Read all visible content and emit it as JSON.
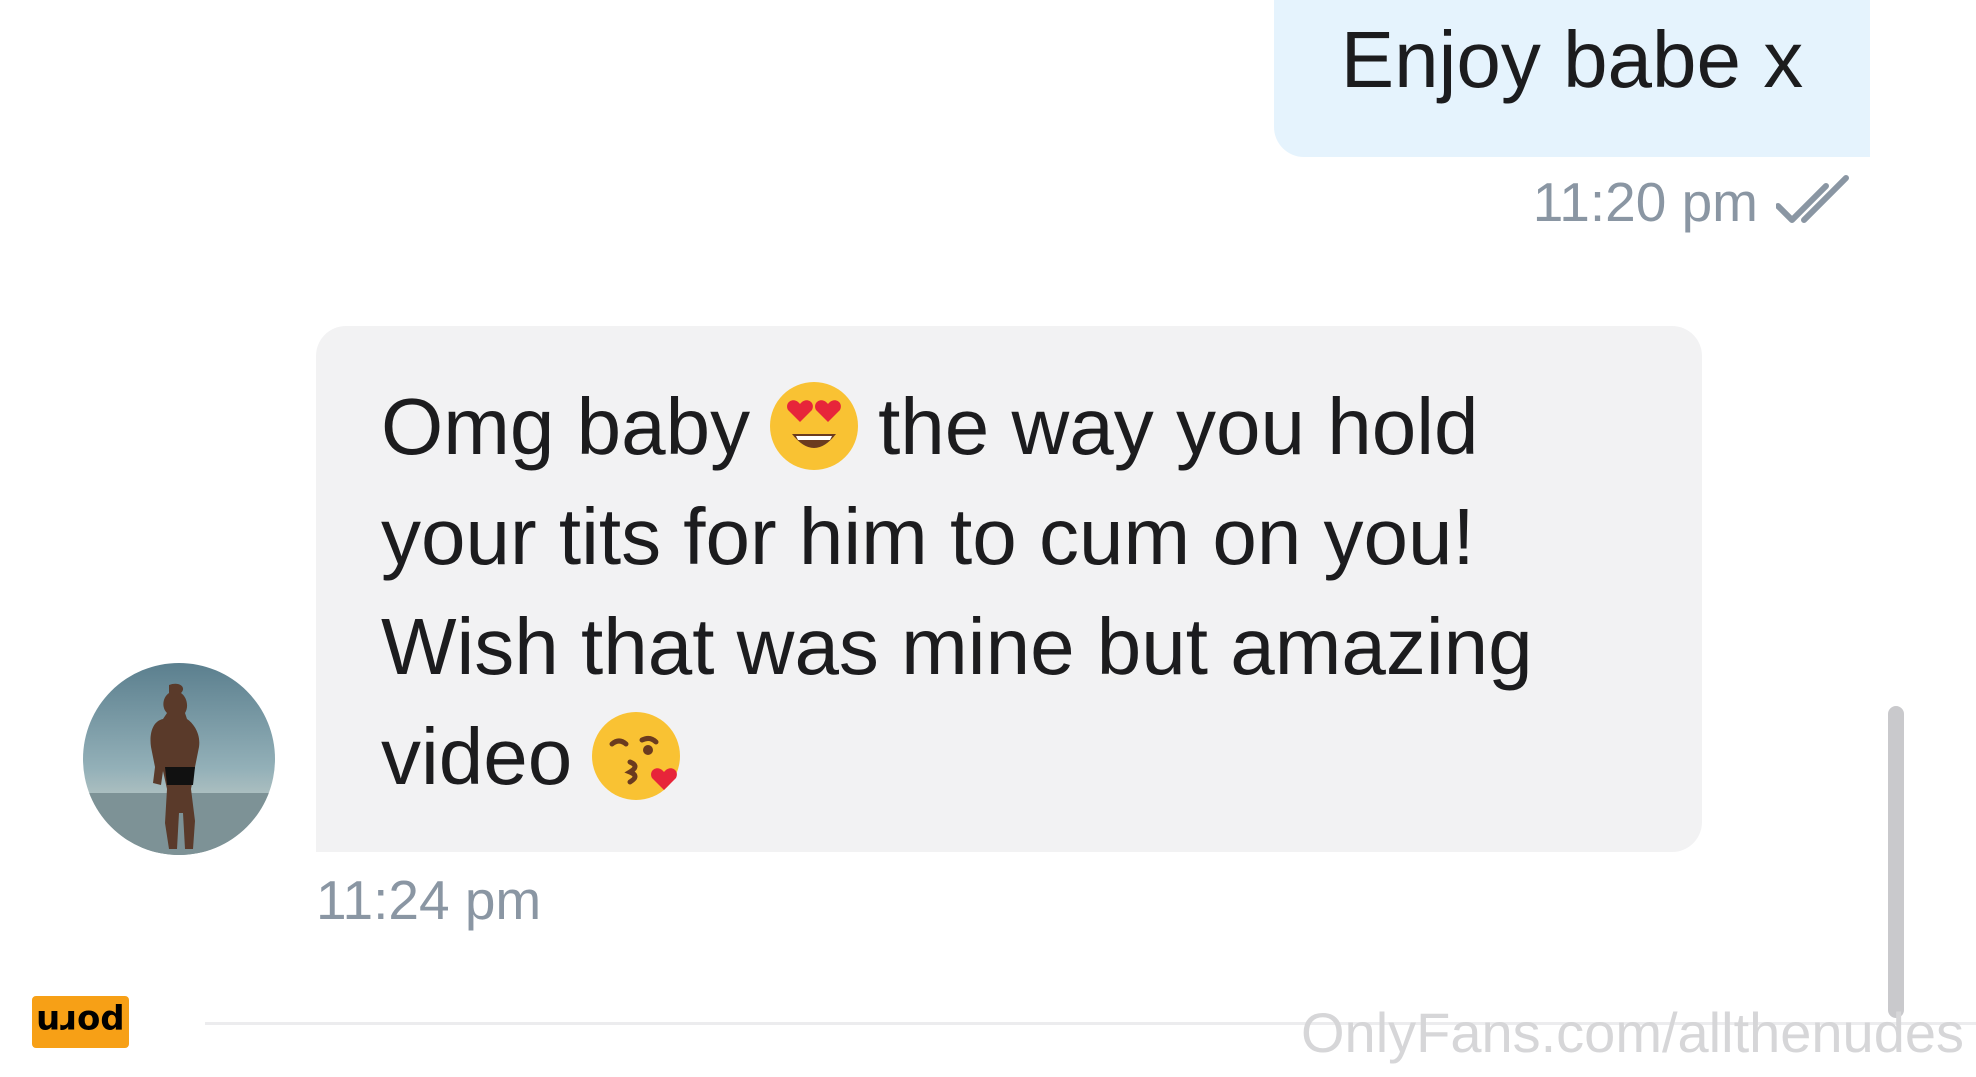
{
  "messages": [
    {
      "direction": "sent",
      "text": "Enjoy babe x",
      "time": "11:20 pm",
      "status_icon": "double-check-icon"
    },
    {
      "direction": "received",
      "lines": [
        {
          "before": "Omg baby",
          "emoji": "heart-eyes-emoji",
          "after": "the way you hold"
        },
        {
          "text": "your tits for him to cum on you!"
        },
        {
          "text": "Wish that was mine but amazing"
        },
        {
          "before": "video",
          "emoji": "kissing-heart-emoji"
        }
      ],
      "time": "11:24 pm",
      "avatar_icon": "user-avatar"
    }
  ],
  "watermark": "OnlyFans.com/allthenudes",
  "logo": {
    "text": "porn",
    "color": "#f7a016"
  },
  "colors": {
    "sent_bubble": "#e5f3fd",
    "received_bubble": "#f2f2f3",
    "meta_text": "#8a96a3",
    "body_text": "#1c1c1e"
  }
}
